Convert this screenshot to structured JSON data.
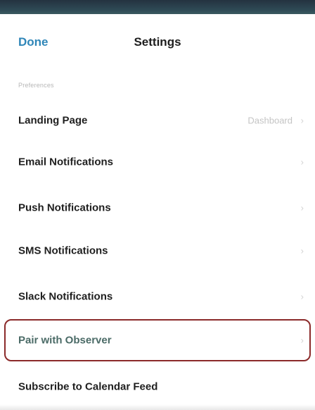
{
  "nav": {
    "done_label": "Done",
    "title": "Settings"
  },
  "section": {
    "header": "Preferences"
  },
  "rows": [
    {
      "label": "Landing Page",
      "value": "Dashboard"
    },
    {
      "label": "Email Notifications"
    },
    {
      "label": "Push Notifications"
    },
    {
      "label": "SMS Notifications"
    },
    {
      "label": "Slack Notifications"
    },
    {
      "label": "Pair with Observer"
    },
    {
      "label": "Subscribe to Calendar Feed"
    }
  ],
  "icons": {
    "chevron": "chevron-right-icon",
    "chevron_glyph": "›"
  },
  "colors": {
    "accent": "#2f86b8",
    "highlight_border": "#8b2a2a"
  }
}
